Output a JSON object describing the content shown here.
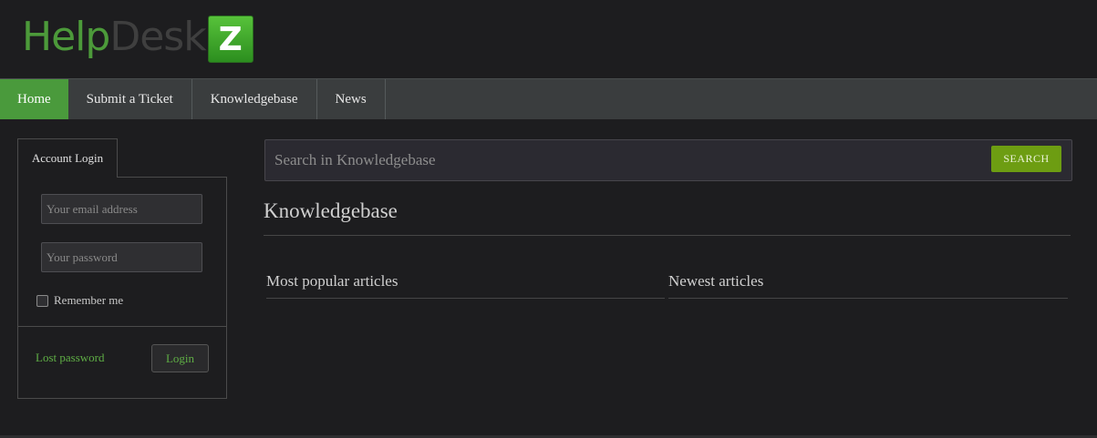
{
  "logo": {
    "part1": "Help",
    "part2": "Desk",
    "badge": "Z"
  },
  "nav": {
    "items": [
      {
        "label": "Home",
        "active": true
      },
      {
        "label": "Submit a Ticket",
        "active": false
      },
      {
        "label": "Knowledgebase",
        "active": false
      },
      {
        "label": "News",
        "active": false
      }
    ]
  },
  "login": {
    "tab_label": "Account Login",
    "email_placeholder": "Your email address",
    "password_placeholder": "Your password",
    "remember_label": "Remember me",
    "lost_password": "Lost password",
    "login_button": "Login"
  },
  "search": {
    "placeholder": "Search in Knowledgebase",
    "button": "SEARCH"
  },
  "knowledgebase": {
    "title": "Knowledgebase",
    "popular_title": "Most popular articles",
    "newest_title": "Newest articles"
  },
  "colors": {
    "accent_green": "#4a9a3c",
    "search_button": "#6d9d12",
    "link_green": "#5fae45",
    "background": "#1d1d1f"
  }
}
